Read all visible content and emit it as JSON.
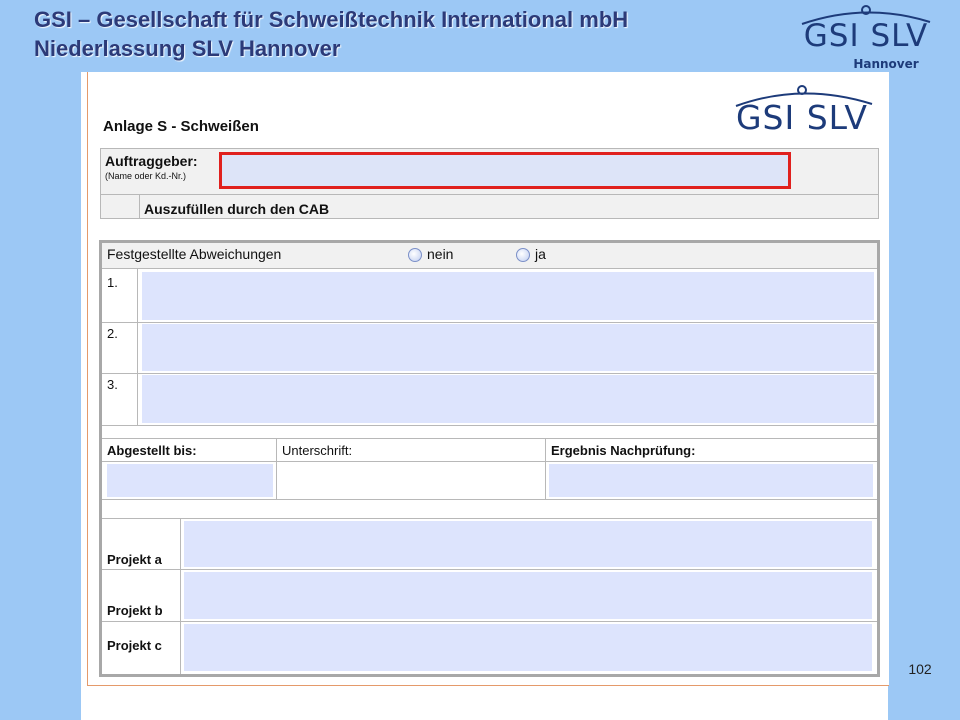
{
  "header": {
    "title_line1": "GSI – Gesellschaft für Schweißtechnik International mbH",
    "title_line2": "Niederlassung SLV Hannover",
    "logo_text": "GSI SLV",
    "logo_subtitle": "Hannover",
    "page_number": "102"
  },
  "document": {
    "logo_text": "GSI SLV",
    "title": "Anlage S - Schweißen",
    "client_label": "Auftraggeber:",
    "client_sublabel": "(Name oder Kd.-Nr.)",
    "client_value": "",
    "cab_label": "Auszufüllen durch den CAB",
    "deviations_label": "Festgestellte Abweichungen",
    "option_no": "nein",
    "option_yes": "ja",
    "deviation_rows": [
      {
        "number": "1.",
        "value": ""
      },
      {
        "number": "2.",
        "value": ""
      },
      {
        "number": "3.",
        "value": ""
      }
    ],
    "columns": {
      "resolved_until": "Abgestellt bis:",
      "signature": "Unterschrift:",
      "recheck_result": "Ergebnis Nachprüfung:"
    },
    "projects": [
      {
        "label": "Projekt a",
        "value": ""
      },
      {
        "label": "Projekt b",
        "value": ""
      },
      {
        "label": "Projekt c",
        "value": ""
      }
    ]
  },
  "colors": {
    "frame_blue": "#9cc8f5",
    "title_blue": "#2c3a78",
    "field_fill": "#dde4fd",
    "highlight_red": "#e0201e"
  }
}
